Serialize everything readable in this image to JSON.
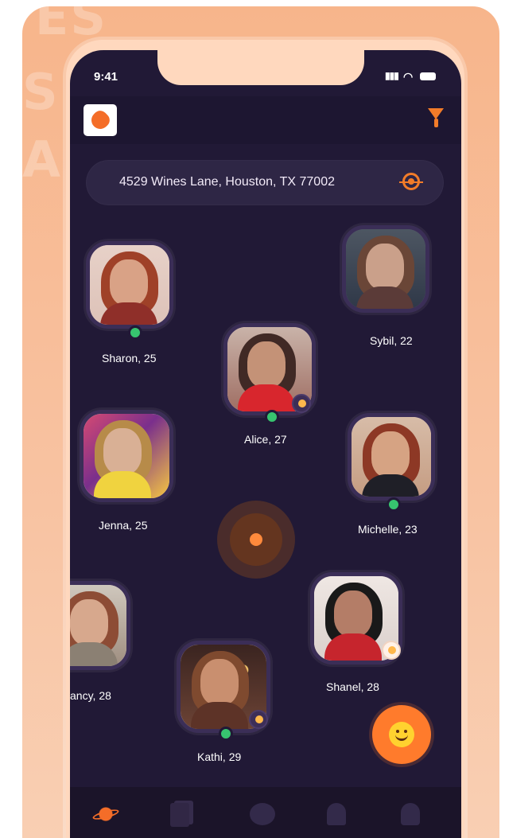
{
  "status_bar": {
    "time": "9:41"
  },
  "background": {
    "line1": "ES",
    "line2": "S",
    "line3": "A"
  },
  "search": {
    "address": "4529 Wines Lane, Houston, TX 77002"
  },
  "profiles": [
    {
      "label": "Sharon, 25"
    },
    {
      "label": "Sybil, 22"
    },
    {
      "label": "Alice, 27"
    },
    {
      "label": "Jenna, 25"
    },
    {
      "label": "Michelle, 23"
    },
    {
      "label": "ancy, 28"
    },
    {
      "label": "Shanel, 28"
    },
    {
      "label": "Kathi, 29"
    }
  ],
  "icons": {
    "logo": "heart-logo-icon",
    "filter": "filter-icon",
    "location": "locate-icon",
    "fab": "smiley-icon",
    "nav": [
      "planet-icon",
      "cards-icon",
      "chat-icon",
      "bell-icon",
      "person-icon"
    ]
  },
  "colors": {
    "accent": "#f46d28",
    "screen_bg": "#211936",
    "online": "#37c46f",
    "frame_bg": "#f7b58b"
  }
}
